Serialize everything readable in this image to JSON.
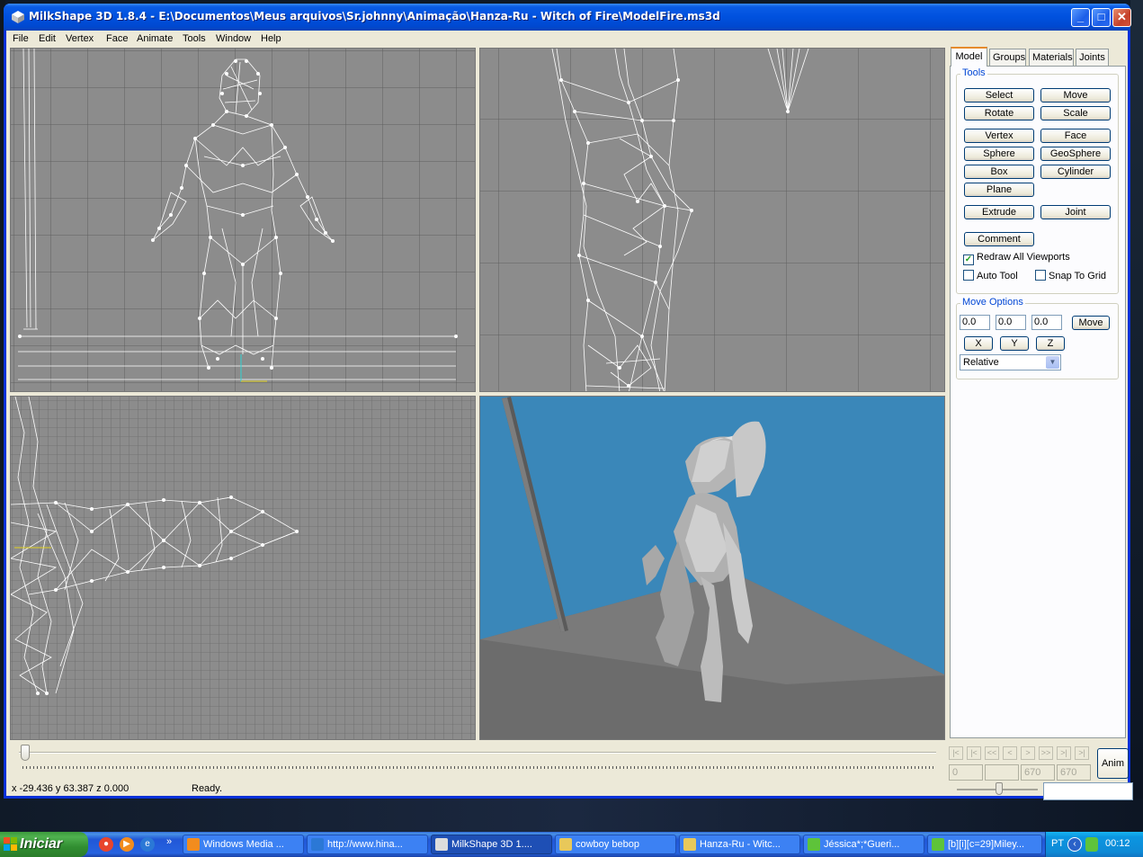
{
  "window": {
    "title": "MilkShape 3D 1.8.4 - E:\\Documentos\\Meus arquivos\\Sr.johnny\\Animação\\Hanza-Ru - Witch of Fire\\ModelFire.ms3d",
    "minimize": "_",
    "maximize": "□",
    "close": "✕"
  },
  "menu": [
    "File",
    "Edit",
    "Vertex",
    "Face",
    "Animate",
    "Tools",
    "Window",
    "Help"
  ],
  "tabs": [
    "Model",
    "Groups",
    "Materials",
    "Joints"
  ],
  "tools": {
    "group_label": "Tools",
    "select": "Select",
    "move": "Move",
    "rotate": "Rotate",
    "scale": "Scale",
    "vertex": "Vertex",
    "face": "Face",
    "sphere": "Sphere",
    "geosphere": "GeoSphere",
    "box": "Box",
    "cylinder": "Cylinder",
    "plane": "Plane",
    "extrude": "Extrude",
    "joint": "Joint",
    "comment": "Comment",
    "redraw_all": "Redraw All Viewports",
    "redraw_all_checked": true,
    "auto_tool": "Auto Tool",
    "auto_tool_checked": false,
    "snap_to_grid": "Snap To Grid",
    "snap_to_grid_checked": false
  },
  "move_options": {
    "group_label": "Move Options",
    "x_value": "0.0",
    "y_value": "0.0",
    "z_value": "0.0",
    "move_button": "Move",
    "x_button": "X",
    "y_button": "Y",
    "z_button": "Z",
    "mode": "Relative"
  },
  "timeline": {
    "nav": [
      "|<",
      "|<",
      "<<",
      "<",
      ">",
      ">>",
      ">|",
      ">|"
    ],
    "frame_current": "0",
    "frame_blank": "",
    "frame_a": "670",
    "frame_b": "670",
    "anim_button": "Anim"
  },
  "status": {
    "coords": "x -29.436 y 63.387 z 0.000",
    "message": "Ready."
  },
  "taskbar": {
    "start": "Iniciar",
    "tasks": [
      "Windows Media ...",
      "http://www.hina...",
      "MilkShape 3D 1....",
      "cowboy bebop",
      "Hanza-Ru - Witc...",
      "Jéssica*;*Gueri...",
      "[b][i][c=29]Miley..."
    ],
    "language": "PT",
    "clock": "00:12",
    "more": "»"
  },
  "colors": {
    "viewport_bg": "#8c8c8c",
    "render_bg": "#3a87b9",
    "titlebar": "#0051de",
    "tab_highlight": "#e68b2c"
  }
}
